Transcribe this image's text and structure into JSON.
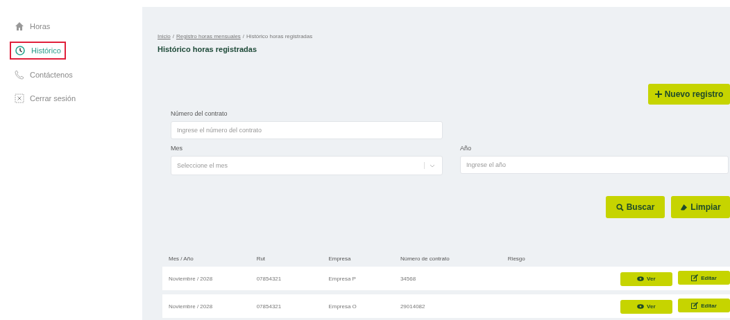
{
  "sidebar": {
    "items": [
      {
        "label": "Horas",
        "kind": "home",
        "selected": false
      },
      {
        "label": "Histórico",
        "kind": "history",
        "selected": true
      },
      {
        "label": "Contáctenos",
        "kind": "contact",
        "selected": false
      },
      {
        "label": "Cerrar sesión",
        "kind": "logout",
        "selected": false
      }
    ]
  },
  "breadcrumb": [
    {
      "label": "Inicio",
      "kind": "link"
    },
    {
      "label": "/",
      "kind": "separator"
    },
    {
      "label": "Registro horas mensuales",
      "kind": "link"
    },
    {
      "label": "/",
      "kind": "separator"
    },
    {
      "label": "Histórico horas registradas",
      "kind": "current"
    }
  ],
  "page_title": "Histórico horas registradas",
  "new_button": "Nuevo registro",
  "filters": {
    "contract": {
      "label": "Número del contrato",
      "placeholder": "Ingrese el número del contrato"
    },
    "month": {
      "label": "Mes",
      "placeholder": "Seleccione el mes"
    },
    "year": {
      "label": "Año",
      "placeholder": "Ingrese el año"
    }
  },
  "search_button": "Buscar",
  "clear_button": "Limpiar",
  "table": {
    "columns": [
      "Mes / Año",
      "Rut",
      "Empresa",
      "Número de contrato",
      "Riesgo"
    ],
    "rows": [
      {
        "cells": [
          "Noviembre / 2028",
          "07854321",
          "Empresa P",
          "34568",
          ""
        ],
        "view": "Ver",
        "edit": "Editar"
      },
      {
        "cells": [
          "Noviembre / 2028",
          "07854321",
          "Empresa O",
          "29014082",
          ""
        ],
        "view": "Ver",
        "edit": "Editar"
      }
    ]
  }
}
